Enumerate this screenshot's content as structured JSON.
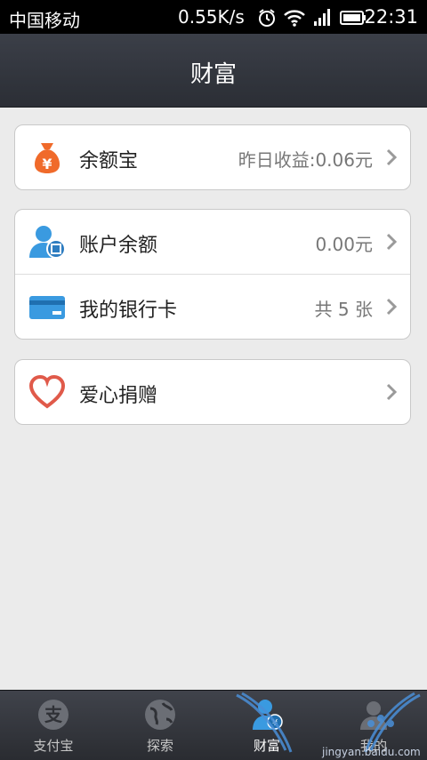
{
  "status_bar": {
    "carrier": "中国移动",
    "speed": "0.55K/s",
    "time": "22:31",
    "icons": [
      "alarm-icon",
      "wifi-icon",
      "signal-icon",
      "battery-icon"
    ]
  },
  "header": {
    "title": "财富"
  },
  "cards": [
    {
      "rows": [
        {
          "label": "余额宝",
          "value": "昨日收益:0.06元",
          "icon": "money-bag-icon"
        }
      ]
    },
    {
      "rows": [
        {
          "label": "账户余额",
          "value": "0.00元",
          "icon": "account-user-icon"
        },
        {
          "label": "我的银行卡",
          "value": "共 5 张",
          "icon": "bank-card-icon"
        }
      ]
    },
    {
      "rows": [
        {
          "label": "爱心捐赠",
          "value": "",
          "icon": "heart-icon"
        }
      ]
    }
  ],
  "tab_bar": {
    "tabs": [
      {
        "label": "支付宝",
        "icon": "alipay-icon"
      },
      {
        "label": "探索",
        "icon": "globe-icon"
      },
      {
        "label": "财富",
        "icon": "wealth-person-icon",
        "active": true
      },
      {
        "label": "我的",
        "icon": "me-icon"
      }
    ]
  },
  "watermark": {
    "text": "jingyan.baidu.com"
  },
  "colors": {
    "header_bg": "#30333a",
    "page_bg": "#ebebeb",
    "accent_blue": "#3a9ae0",
    "bag_orange": "#f06a2a",
    "heart_red": "#e05a4a"
  }
}
